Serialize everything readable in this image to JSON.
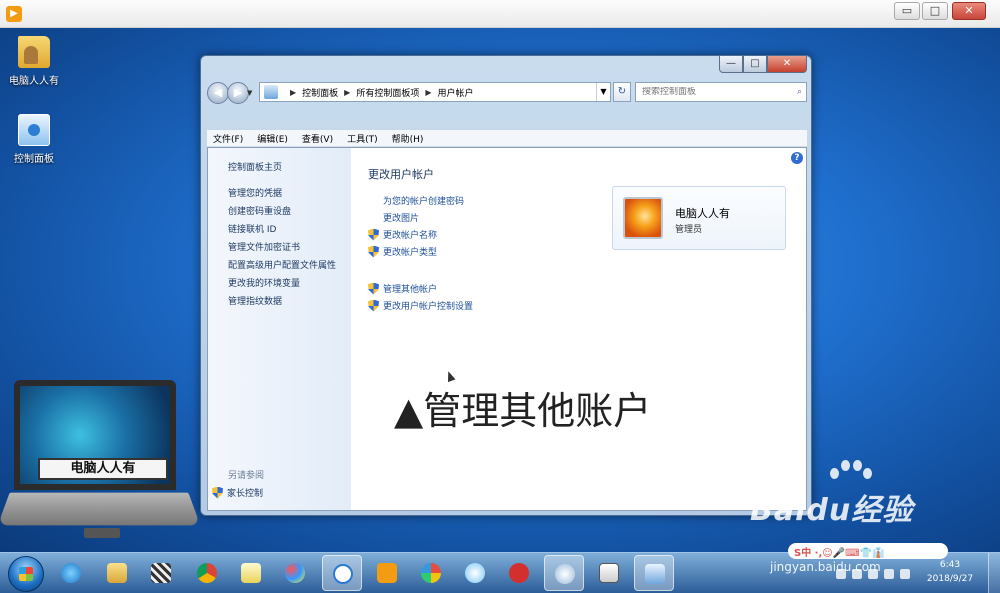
{
  "desktop": {
    "icons": [
      {
        "label": "电脑人人有"
      },
      {
        "label": "控制面板"
      }
    ]
  },
  "window": {
    "breadcrumb": [
      "控制面板",
      "所有控制面板项",
      "用户帐户"
    ],
    "search_placeholder": "搜索控制面板",
    "menu": [
      "文件(F)",
      "编辑(E)",
      "查看(V)",
      "工具(T)",
      "帮助(H)"
    ],
    "left_pane": {
      "items": [
        "控制面板主页",
        "管理您的凭据",
        "创建密码重设盘",
        "链接联机 ID",
        "管理文件加密证书",
        "配置高级用户配置文件属性",
        "更改我的环境变量",
        "管理指纹数据"
      ],
      "see_also": "另请参阅",
      "parental": "家长控制"
    },
    "main": {
      "title": "更改用户帐户",
      "links": [
        "为您的帐户创建密码",
        "更改图片",
        "更改帐户名称",
        "更改帐户类型"
      ],
      "links2": [
        "管理其他帐户",
        "更改用户帐户控制设置"
      ]
    },
    "account": {
      "name": "电脑人人有",
      "role": "管理员"
    }
  },
  "overlay_caption": "▲管理其他账户",
  "laptop_label": "电脑人人有",
  "watermark": {
    "brand": "Bai",
    "brand2": "du",
    "brand3": "经验",
    "site": "jingyan.baidu.com"
  },
  "ime_bar": "S中 ·,☺🎤⌨👕👔",
  "clock": {
    "time": "6:43",
    "date": "2018/9/27"
  },
  "colors": {
    "desktop": "#1f6fce",
    "link": "#1e4f9a"
  }
}
